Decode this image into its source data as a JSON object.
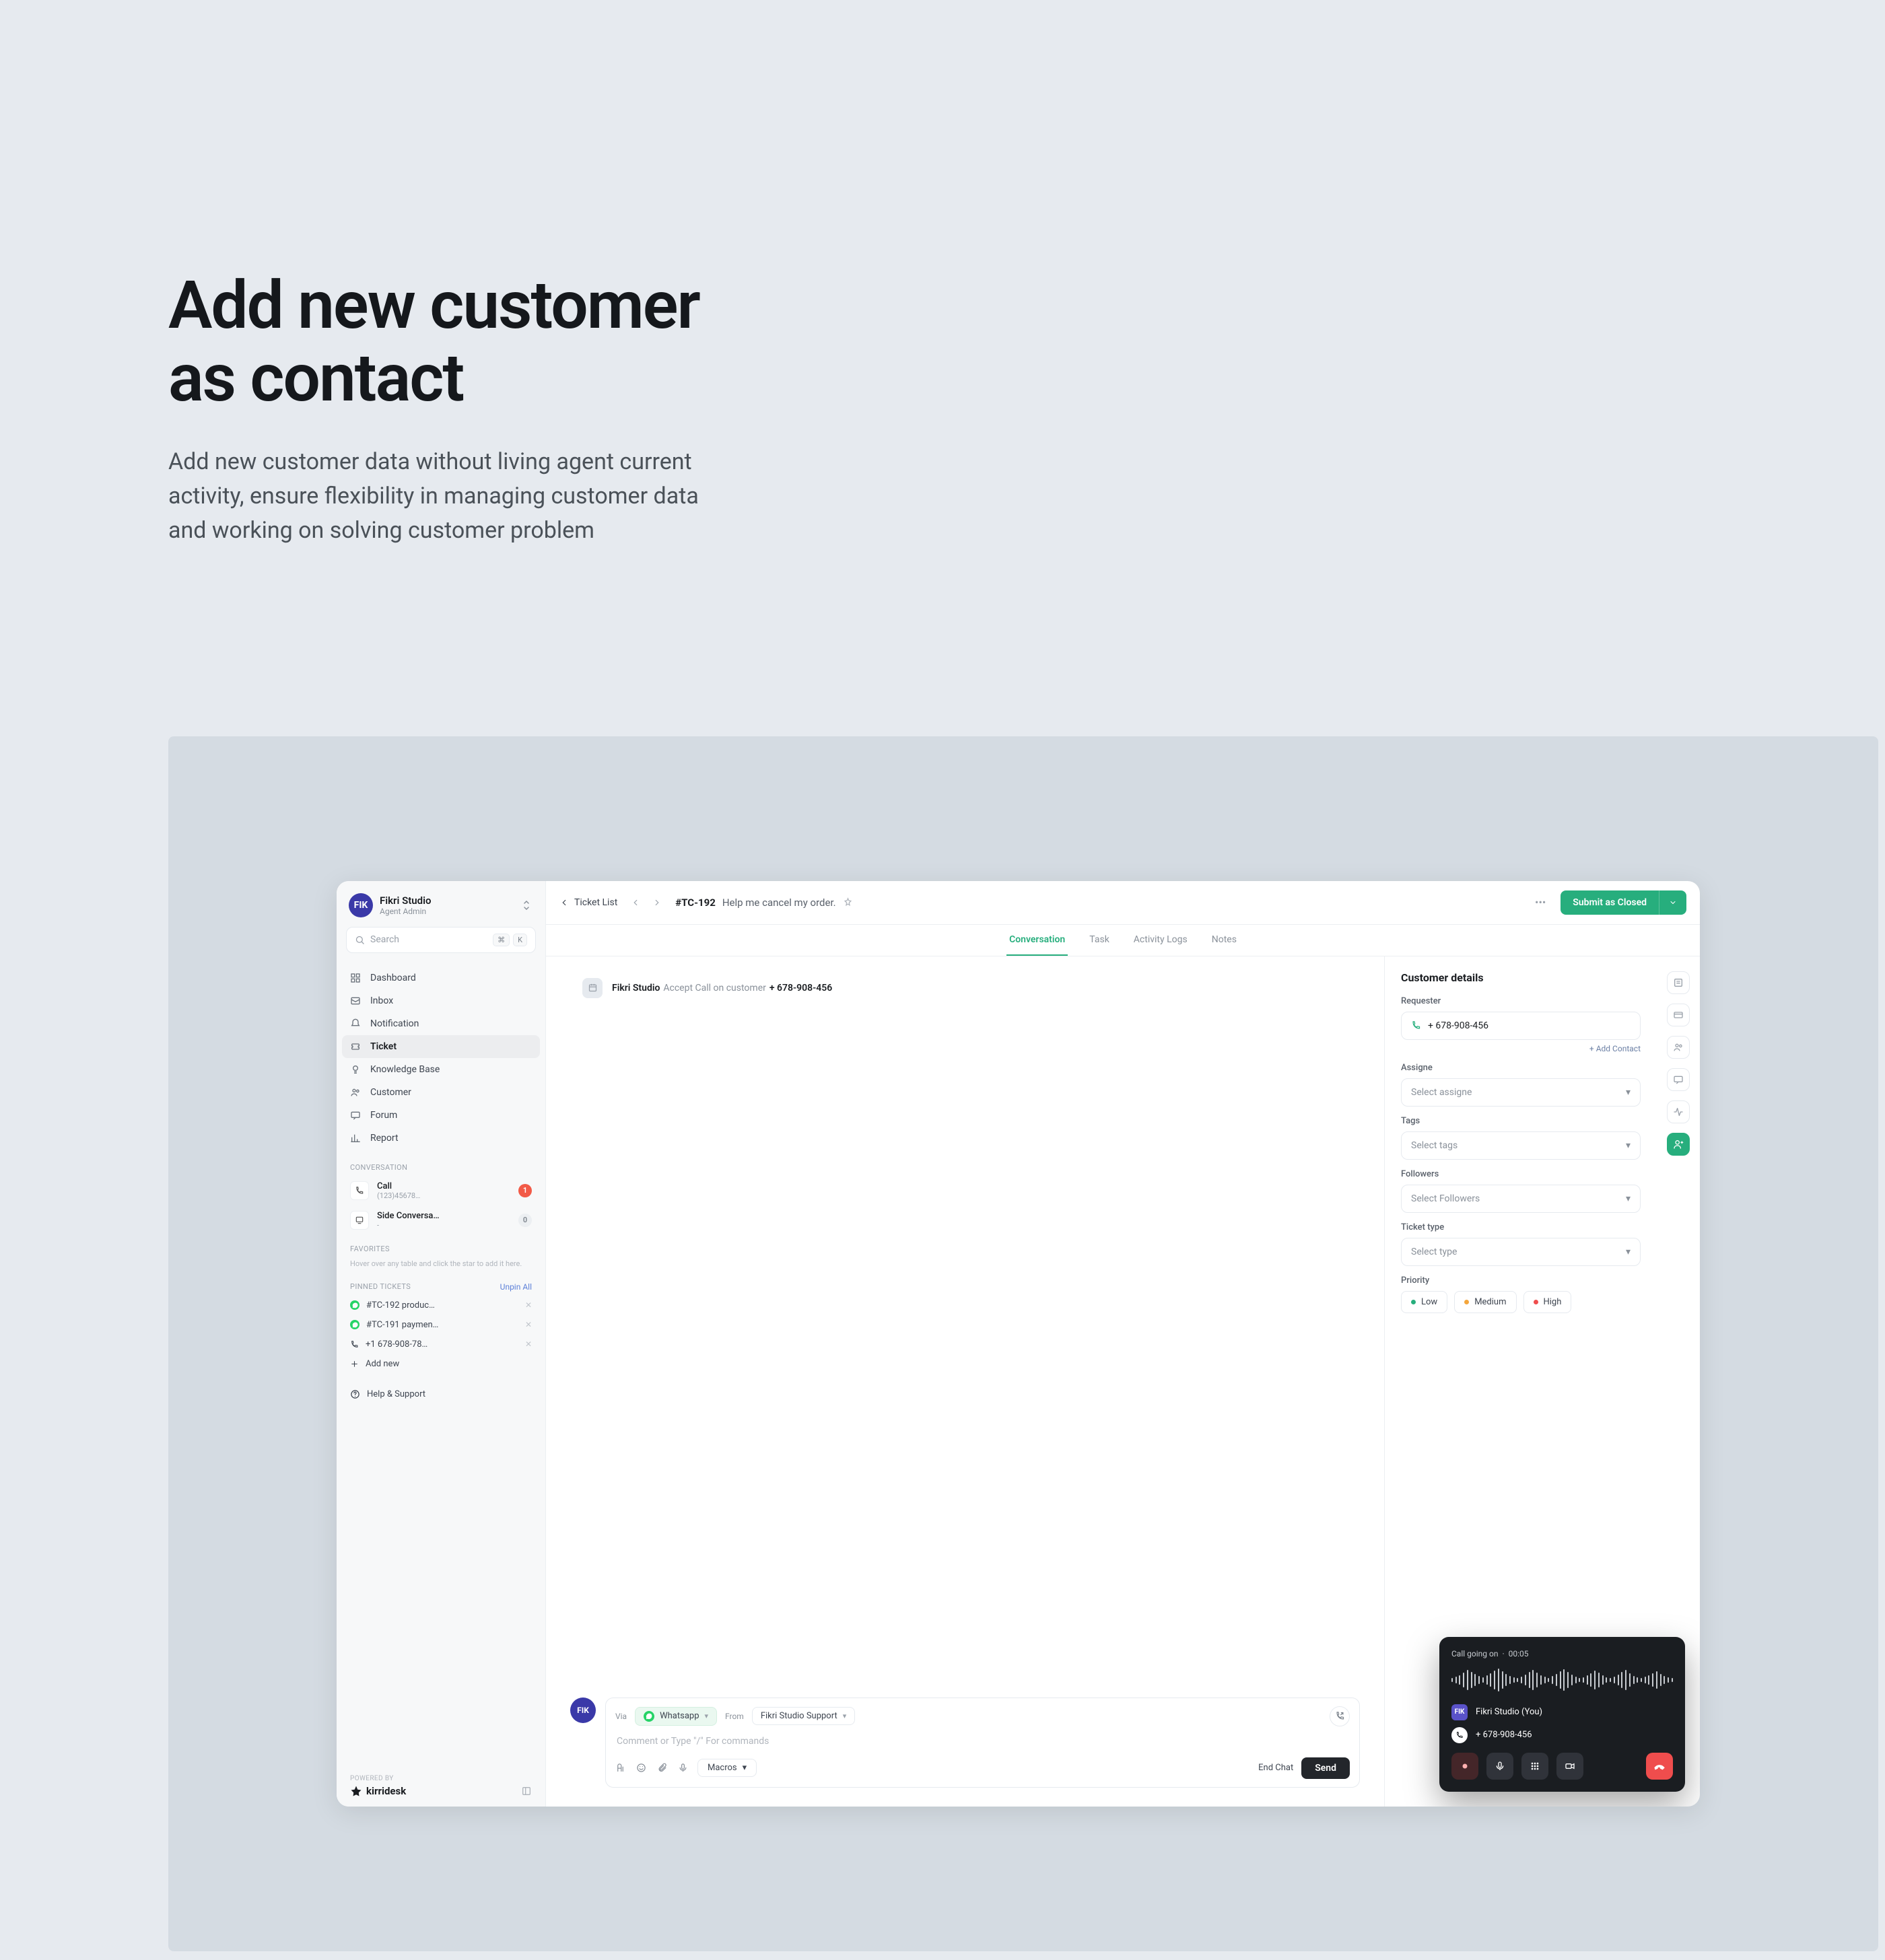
{
  "hero": {
    "title_l1": "Add new customer",
    "title_l2": "as contact",
    "desc": "Add new customer data without living agent current activity, ensure flexibility in managing customer data and working on solving customer problem"
  },
  "org": {
    "name": "Fikri Studio",
    "role": "Agent Admin"
  },
  "search": {
    "placeholder": "Search",
    "kbd1": "⌘",
    "kbd2": "K"
  },
  "nav": {
    "dashboard": "Dashboard",
    "inbox": "Inbox",
    "notification": "Notification",
    "ticket": "Ticket",
    "kb": "Knowledge Base",
    "customer": "Customer",
    "forum": "Forum",
    "report": "Report"
  },
  "conversation_label": "CONVERSATION",
  "conv": {
    "call_title": "Call",
    "call_sub": "(123)45678…",
    "call_badge": "1",
    "side_title": "Side Conversa…",
    "side_sub": "-",
    "side_badge": "0"
  },
  "favorites_label": "FAVORITES",
  "favorites_hint": "Hover over any table and click the star to add it here.",
  "pinned_label": "PINNED TICKETS",
  "unpin_all": "Unpin All",
  "pins": {
    "p1": "#TC-192 produc…",
    "p2": "#TC-191 paymen…",
    "p3": "+1 678-908-78…",
    "add": "Add new"
  },
  "help": "Help & Support",
  "powered_by": "POWERED BY",
  "brand": "kirridesk",
  "topbar": {
    "back": "Ticket List",
    "id": "#TC-192",
    "title": "Help me cancel my order.",
    "submit": "Submit as Closed"
  },
  "tabs": {
    "conversation": "Conversation",
    "task": "Task",
    "activity": "Activity Logs",
    "notes": "Notes"
  },
  "sysmsg": {
    "actor": "Fikri Studio",
    "action": "Accept Call on customer",
    "number": "+ 678-908-456"
  },
  "composer": {
    "via": "Via",
    "whatsapp": "Whatsapp",
    "from_lbl": "From",
    "from_val": "Fikri Studio Support",
    "placeholder": "Comment or Type \"/\" For commands",
    "macros": "Macros",
    "endchat": "End Chat",
    "send": "Send"
  },
  "details": {
    "title": "Customer details",
    "requester": "Requester",
    "phone": "+ 678-908-456",
    "add_contact": "+ Add Contact",
    "assigne_lbl": "Assigne",
    "assigne_ph": "Select assigne",
    "tags_lbl": "Tags",
    "tags_ph": "Select tags",
    "followers_lbl": "Followers",
    "followers_ph": "Select Followers",
    "type_lbl": "Ticket type",
    "type_ph": "Select type",
    "priority_lbl": "Priority",
    "low": "Low",
    "medium": "Medium",
    "high": "High"
  },
  "call": {
    "status": "Call going on",
    "sep": "·",
    "time": "00:05",
    "party1": "Fikri Studio (You)",
    "party2": "+ 678-908-456"
  }
}
